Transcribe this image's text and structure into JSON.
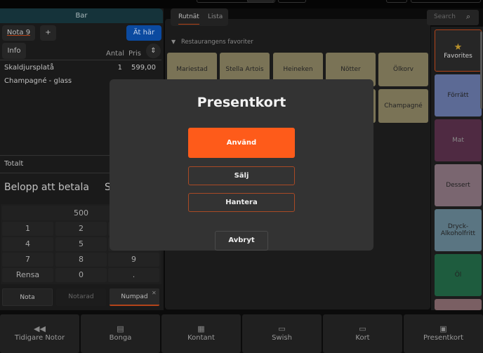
{
  "left": {
    "header": "Bar",
    "nota_tab": "Nota 9",
    "add_label": "+",
    "eat_here": "Ät här",
    "info": "Info",
    "col_qty": "Antal",
    "col_price": "Pris",
    "items": [
      {
        "name": "Skaldjursplatå",
        "qty": "1",
        "price": "599,00"
      },
      {
        "name": "Champagné - glass",
        "qty": "",
        "price": ""
      }
    ],
    "total_label": "Totalt",
    "amount_label": "Belopp att betala",
    "amount_value_partial": "S",
    "numpad": {
      "display": "500",
      "keys": [
        "1",
        "2",
        "",
        "4",
        "5",
        "",
        "7",
        "8",
        "9",
        "Rensa",
        "0",
        "."
      ]
    },
    "tabs": [
      "Nota",
      "Notarad",
      "Numpad"
    ]
  },
  "main": {
    "tabs": [
      "Rutnät",
      "Lista"
    ],
    "search_placeholder": "Search",
    "section": "Restaurangens favoriter",
    "tiles": [
      "Mariestad",
      "Stella Artois",
      "Heineken",
      "Nötter",
      "Ölkorv",
      "Champagné"
    ]
  },
  "categories": [
    {
      "label": "Favorites",
      "color": "#262626"
    },
    {
      "label": "Förrätt",
      "color": "#5c6a95"
    },
    {
      "label": "Mat",
      "color": "#4f2a42"
    },
    {
      "label": "Dessert",
      "color": "#7a6670"
    },
    {
      "label": "Dryck-Alkoholfritt",
      "color": "#5a7582"
    },
    {
      "label": "Öl",
      "color": "#1e5c3e"
    },
    {
      "label": "",
      "color": "#7a5f63"
    }
  ],
  "bottom": [
    {
      "label": "Tidigare Notor",
      "icon": "rewind-icon"
    },
    {
      "label": "Bonga",
      "icon": "receipt-icon"
    },
    {
      "label": "Kontant",
      "icon": "cash-icon"
    },
    {
      "label": "Swish",
      "icon": "card-icon"
    },
    {
      "label": "Kort",
      "icon": "card-icon"
    },
    {
      "label": "Presentkort",
      "icon": "gift-card-icon"
    }
  ],
  "modal": {
    "title": "Presentkort",
    "use": "Använd",
    "sell": "Sälj",
    "manage": "Hantera",
    "cancel": "Avbryt"
  },
  "colors": {
    "accent": "#fe5b1a",
    "blue": "#0b4aa0"
  }
}
